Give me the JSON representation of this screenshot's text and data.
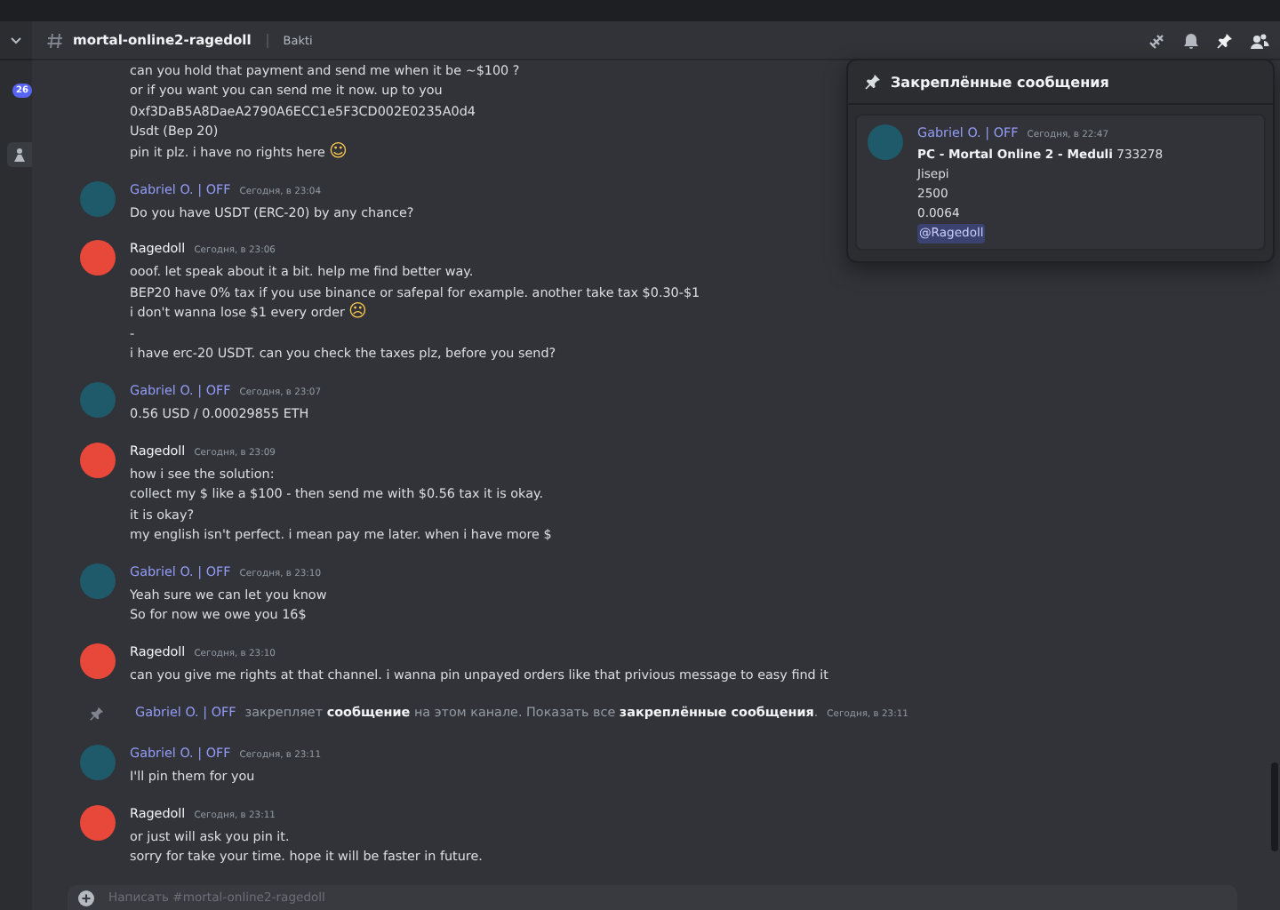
{
  "sidebar": {
    "badge": "26"
  },
  "channel": {
    "name": "mortal-online2-ragedoll",
    "topic": "Bakti"
  },
  "continuation_lines": [
    {
      "text": "can you hold that payment and send me when it be ~$100 ?"
    },
    {
      "text": "or if you want you can send me it now. up to you"
    },
    {
      "text": "0xf3DaB5A8DaeA2790A6ECC1e5F3CD002E0235A0d4"
    },
    {
      "text": "Usdt (Bep 20)"
    },
    {
      "text": "pin it plz. i have no rights here",
      "emoji": "☺"
    }
  ],
  "messages": [
    {
      "kind": "user",
      "author": "Gabriel O. | OFF",
      "color": "#949cf7",
      "avatar": {
        "color": "#1f5a6a"
      },
      "time": "Сегодня, в 23:04",
      "lines": [
        {
          "text": "Do you have USDT (ERC-20) by any chance?"
        }
      ]
    },
    {
      "kind": "user",
      "author": "Ragedoll",
      "color": "#f2f3f5",
      "avatar": {
        "color": "#e8483a"
      },
      "time": "Сегодня, в 23:06",
      "lines": [
        {
          "text": "ooof. let speak about it a bit. help me find better way."
        },
        {
          "text": "BEP20 have 0% tax if you use binance or safepal for example. another take tax $0.30-$1"
        },
        {
          "text": "i don't wanna lose $1 every order",
          "emoji": "☹"
        },
        {
          "text": "-"
        },
        {
          "text": "i have erc-20 USDT. can you check the taxes plz, before you send?"
        }
      ]
    },
    {
      "kind": "user",
      "author": "Gabriel O. | OFF",
      "color": "#949cf7",
      "avatar": {
        "color": "#1f5a6a"
      },
      "time": "Сегодня, в 23:07",
      "lines": [
        {
          "text": "0.56 USD / 0.00029855 ETH"
        }
      ]
    },
    {
      "kind": "user",
      "author": "Ragedoll",
      "color": "#f2f3f5",
      "avatar": {
        "color": "#e8483a"
      },
      "time": "Сегодня, в 23:09",
      "lines": [
        {
          "text": "how i see the solution:"
        },
        {
          "text": "collect my $ like a $100 - then send me with $0.56 tax it is okay."
        },
        {
          "text": "it is okay?"
        },
        {
          "text": "my english isn't perfect. i mean pay me later. when i have more $"
        }
      ]
    },
    {
      "kind": "user",
      "author": "Gabriel O. | OFF",
      "color": "#949cf7",
      "avatar": {
        "color": "#1f5a6a"
      },
      "time": "Сегодня, в 23:10",
      "lines": [
        {
          "text": "Yeah sure we can let you know"
        },
        {
          "text": "So for now we owe you 16$"
        }
      ]
    },
    {
      "kind": "user",
      "author": "Ragedoll",
      "color": "#f2f3f5",
      "avatar": {
        "color": "#e8483a"
      },
      "time": "Сегодня, в 23:10",
      "lines": [
        {
          "text": "can you give me rights at that channel. i wanna pin unpayed orders like that privious message to easy find it"
        }
      ]
    },
    {
      "kind": "system",
      "author": "Gabriel O. | OFF",
      "color": "#949cf7",
      "time": "Сегодня, в 23:11",
      "text": "закрепляет **сообщение** на этом канале. Показать все **закреплённые сообщения**."
    },
    {
      "kind": "user",
      "author": "Gabriel O. | OFF",
      "color": "#949cf7",
      "avatar": {
        "color": "#1f5a6a"
      },
      "time": "Сегодня, в 23:11",
      "lines": [
        {
          "text": "I'll pin them for you"
        }
      ]
    },
    {
      "kind": "user",
      "author": "Ragedoll",
      "color": "#f2f3f5",
      "avatar": {
        "color": "#e8483a"
      },
      "time": "Сегодня, в 23:11",
      "lines": [
        {
          "text": "or just will ask you pin it."
        },
        {
          "text": "sorry for take your time. hope it will be faster in future."
        }
      ]
    }
  ],
  "pinned_popup": {
    "title": "Закреплённые сообщения",
    "message": {
      "author": "Gabriel O. | OFF",
      "color": "#949cf7",
      "avatar": {
        "color": "#1f5a6a"
      },
      "time": "Сегодня, в 22:47",
      "lines": [
        "**PC - Mortal Online 2 - Meduli** 733278",
        "Jisepi",
        "2500",
        "0.0064"
      ],
      "mention": "@Ragedoll"
    }
  },
  "composer": {
    "placeholder": "Написать #mortal-online2-ragedoll"
  }
}
